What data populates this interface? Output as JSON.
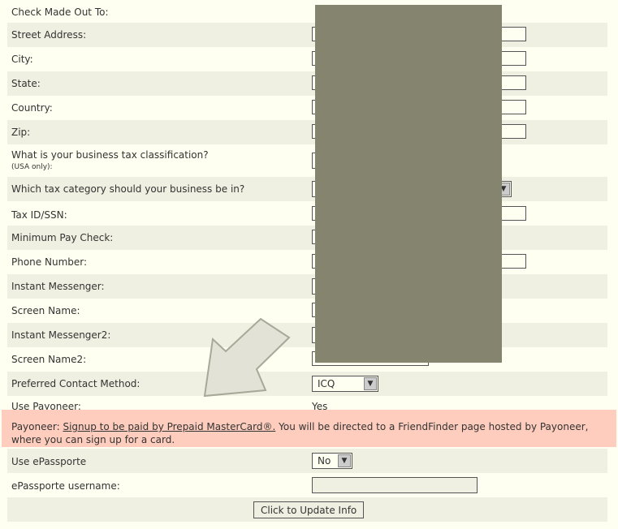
{
  "rows": [
    {
      "label": "Check Made Out To:"
    },
    {
      "label": "Street Address:"
    },
    {
      "label": "City:"
    },
    {
      "label": "State:"
    },
    {
      "label": "Country:"
    },
    {
      "label": "Zip:"
    },
    {
      "label": "What is your business tax classification?",
      "note": "(USA only):"
    },
    {
      "label": "Which tax category should your business be in?"
    },
    {
      "label": "Tax ID/SSN:"
    },
    {
      "label": "Minimum Pay Check:"
    },
    {
      "label": "Phone Number:"
    },
    {
      "label": "Instant Messenger:"
    },
    {
      "label": "Screen Name:"
    },
    {
      "label": "Instant Messenger2:"
    },
    {
      "label": "Screen Name2:"
    },
    {
      "label": "Preferred Contact Method:",
      "value": "ICQ"
    },
    {
      "label": "Use Payoneer:",
      "value": "Yes"
    },
    {
      "label": "Use ePassporte",
      "value": "No"
    },
    {
      "label": "ePassporte username:"
    }
  ],
  "payoneer": {
    "prefix": "Payoneer: ",
    "link": "Signup to be paid by Prepaid MasterCard®.",
    "suffix": " You will be directed to a FriendFinder page hosted by Payoneer, where you can sign up for a card."
  },
  "submit_label": "Click to Update Info",
  "colors": {
    "redaction": "#84846f",
    "highlight": "#fecdbd",
    "row_alt": "#f0f0e2"
  }
}
